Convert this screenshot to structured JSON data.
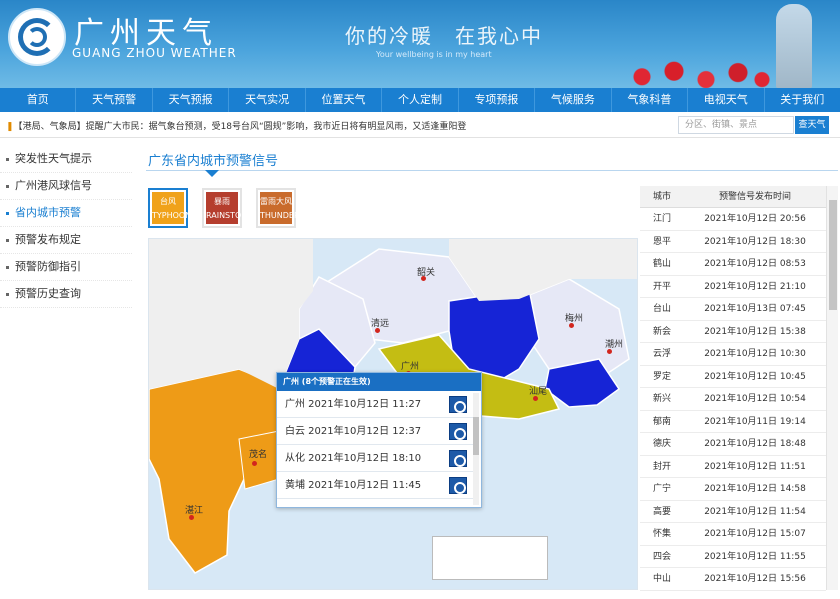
{
  "header": {
    "title_cn": "广州天气",
    "title_en": "GUANG ZHOU WEATHER",
    "slogan": "你的冷暖　在我心中",
    "slogan_en": "Your wellbeing is in my heart"
  },
  "nav": [
    "首页",
    "天气预警",
    "天气预报",
    "天气实况",
    "位置天气",
    "个人定制",
    "专项预报",
    "气候服务",
    "气象科普",
    "电视天气",
    "关于我们"
  ],
  "ticker": {
    "prefix": "【",
    "text": "港局、气象局】提醒广大市民：据气象台预测，受18号台风“圆规”影响，我市近日将有明显风雨，又适逢重阳登"
  },
  "search": {
    "placeholder": "分区、街镇、景点",
    "button": "查天气"
  },
  "sidebar": [
    {
      "label": "突发性天气提示"
    },
    {
      "label": "广州港风球信号"
    },
    {
      "label": "省内城市预警"
    },
    {
      "label": "预警发布规定"
    },
    {
      "label": "预警防御指引"
    },
    {
      "label": "预警历史查询"
    }
  ],
  "section": {
    "title": "广东省内城市预警信号"
  },
  "signals": [
    {
      "name": "台风",
      "level": "橙",
      "code": "TYPHOON"
    },
    {
      "name": "暴雨",
      "level": "红",
      "code": "RAINSTORM"
    },
    {
      "name": "雷雨大风",
      "level": "橙",
      "code": "THUNDER"
    }
  ],
  "map": {
    "cities": [
      "韶关",
      "清远",
      "梅州",
      "潮州",
      "广州",
      "汕尾",
      "茂名",
      "湛江"
    ],
    "colors": {
      "orange": "#ee9b17",
      "blue": "#1624d6",
      "olive": "#c4bd13",
      "lavender": "#e6e8f6"
    }
  },
  "popup": {
    "title": "广州 (8个预警正在生效)",
    "rows": [
      {
        "text": "广州  2021年10月12日 11:27"
      },
      {
        "text": "白云  2021年10月12日 12:37"
      },
      {
        "text": "从化  2021年10月12日 18:10"
      },
      {
        "text": "黄埔  2021年10月12日 11:45"
      }
    ]
  },
  "table": {
    "headers": [
      "城市",
      "预警信号发布时间"
    ],
    "rows": [
      [
        "江门",
        "2021年10月12日 20:56"
      ],
      [
        "恩平",
        "2021年10月12日 18:30"
      ],
      [
        "鹤山",
        "2021年10月12日 08:53"
      ],
      [
        "开平",
        "2021年10月12日 21:10"
      ],
      [
        "台山",
        "2021年10月13日 07:45"
      ],
      [
        "新会",
        "2021年10月12日 15:38"
      ],
      [
        "云浮",
        "2021年10月12日 10:30"
      ],
      [
        "罗定",
        "2021年10月12日 10:45"
      ],
      [
        "新兴",
        "2021年10月12日 10:54"
      ],
      [
        "郁南",
        "2021年10月11日 19:14"
      ],
      [
        "德庆",
        "2021年10月12日 18:48"
      ],
      [
        "封开",
        "2021年10月12日 11:51"
      ],
      [
        "广宁",
        "2021年10月12日 14:58"
      ],
      [
        "高要",
        "2021年10月12日 11:54"
      ],
      [
        "怀集",
        "2021年10月12日 15:07"
      ],
      [
        "四会",
        "2021年10月12日 11:55"
      ],
      [
        "中山",
        "2021年10月12日 15:56"
      ]
    ]
  }
}
